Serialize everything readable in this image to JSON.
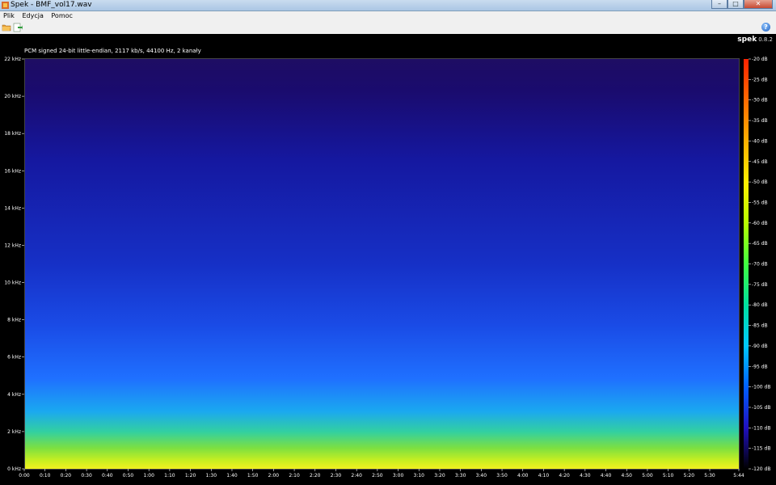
{
  "window": {
    "title": "Spek - BMF_vol17.wav",
    "controls": {
      "minimize": "–",
      "maximize": "□",
      "close": "✕"
    }
  },
  "menu": {
    "items": [
      "Plik",
      "Edycja",
      "Pomoc"
    ]
  },
  "toolbar": {
    "help_glyph": "?"
  },
  "brand": {
    "name": "spek",
    "version": "0.8.2"
  },
  "file_info": "PCM signed 24-bit little-endian, 2117 kb/s, 44100 Hz, 2 kanały",
  "chart_data": {
    "type": "heatmap",
    "title": "PCM signed 24-bit little-endian, 2117 kb/s, 44100 Hz, 2 kanały",
    "x": {
      "unit": "time",
      "range_seconds": [
        0,
        344
      ],
      "tick_labels": [
        "0:00",
        "0:10",
        "0:20",
        "0:30",
        "0:40",
        "0:50",
        "1:00",
        "1:10",
        "1:20",
        "1:30",
        "1:40",
        "1:50",
        "2:00",
        "2:10",
        "2:20",
        "2:30",
        "2:40",
        "2:50",
        "3:00",
        "3:10",
        "3:20",
        "3:30",
        "3:40",
        "3:50",
        "4:00",
        "4:10",
        "4:20",
        "4:30",
        "4:40",
        "4:50",
        "5:00",
        "5:10",
        "5:20",
        "5:30",
        "5:44"
      ],
      "tick_seconds": [
        0,
        10,
        20,
        30,
        40,
        50,
        60,
        70,
        80,
        90,
        100,
        110,
        120,
        130,
        140,
        150,
        160,
        170,
        180,
        190,
        200,
        210,
        220,
        230,
        240,
        250,
        260,
        270,
        280,
        290,
        300,
        310,
        320,
        330,
        344
      ]
    },
    "y": {
      "unit": "kHz",
      "range": [
        0,
        22
      ],
      "tick_labels": [
        "0 kHz",
        "2 kHz",
        "4 kHz",
        "6 kHz",
        "8 kHz",
        "10 kHz",
        "12 kHz",
        "14 kHz",
        "16 kHz",
        "18 kHz",
        "20 kHz",
        "22 kHz"
      ],
      "tick_values": [
        0,
        2,
        4,
        6,
        8,
        10,
        12,
        14,
        16,
        18,
        20,
        22
      ]
    },
    "color_scale": {
      "unit": "dB",
      "range": [
        -120,
        -20
      ],
      "tick_labels": [
        "-20 dB",
        "-25 dB",
        "-30 dB",
        "-35 dB",
        "-40 dB",
        "-45 dB",
        "-50 dB",
        "-55 dB",
        "-60 dB",
        "-65 dB",
        "-70 dB",
        "-75 dB",
        "-80 dB",
        "-85 dB",
        "-90 dB",
        "-95 dB",
        "-100 dB",
        "-105 dB",
        "-110 dB",
        "-115 dB",
        "-120 dB"
      ],
      "tick_values": [
        -20,
        -25,
        -30,
        -35,
        -40,
        -45,
        -50,
        -55,
        -60,
        -65,
        -70,
        -75,
        -80,
        -85,
        -90,
        -95,
        -100,
        -105,
        -110,
        -115,
        -120
      ],
      "colors": [
        "#ff2200",
        "#ff6a00",
        "#ffb000",
        "#ffee00",
        "#b8ff00",
        "#40ff40",
        "#00e0a0",
        "#00c8ff",
        "#0060ff",
        "#2010c0",
        "#000000"
      ]
    }
  }
}
